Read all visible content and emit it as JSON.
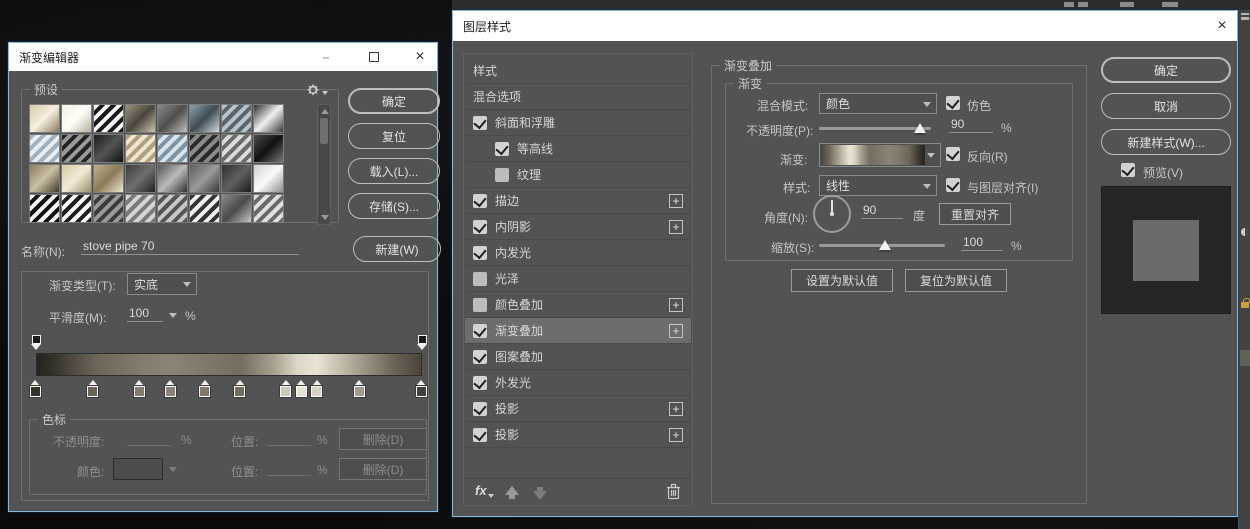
{
  "colors": {
    "dialog_bg": "#535353",
    "titlebar_bg": "#ffffff",
    "accent_border": "#86b7dc",
    "selected_row": "#6d6d6d",
    "disabled_text": "#8f8f8f",
    "preview_bg": "#262626",
    "preview_inner": "#6a6a6a"
  },
  "gradient_editor": {
    "title": "渐变编辑器",
    "window_buttons": {
      "minimize": "–",
      "maximize": "",
      "close": "×"
    },
    "presets_label": "预设",
    "gear_icon": "gear-menu",
    "buttons": {
      "ok": "确定",
      "reset": "复位",
      "load": "载入(L)...",
      "save": "存储(S)..."
    },
    "name_label": "名称(N):",
    "name_value": "stove pipe 70",
    "new_button": "新建(W)",
    "type_label": "渐变类型(T):",
    "type_value": "实底",
    "smoothness_label": "平滑度(M):",
    "smoothness_value": "100",
    "percent": "%",
    "stops_section_label": "色标",
    "opacity_row": {
      "label": "不透明度:",
      "value": "",
      "location_label": "位置:",
      "location_value": "",
      "unit": "%",
      "delete": "删除(D)"
    },
    "color_row": {
      "label": "颜色:",
      "location_label": "位置:",
      "location_value": "",
      "unit": "%",
      "delete": "删除(D)"
    },
    "swatches": [
      {
        "g": [
          "#d9c9a8",
          "#f5efe0",
          "#8a7a5e"
        ]
      },
      {
        "g": [
          "#f2efe6",
          "#fffdf8",
          "#b8b0a0"
        ]
      },
      {
        "st": [
          "#f8f8f8",
          "#1a1a1a"
        ]
      },
      {
        "g": [
          "#9a937f",
          "#4a463c",
          "#c8c2ae"
        ]
      },
      {
        "g": [
          "#8a8a8a",
          "#4e4e4e",
          "#c0c0c0"
        ]
      },
      {
        "g": [
          "#8fa2ad",
          "#3e4a52",
          "#cdd8de"
        ]
      },
      {
        "st": [
          "#b8c4cc",
          "#5a646b"
        ]
      },
      {
        "g": [
          "#2e2e2e",
          "#f0f0f0",
          "#3a3a3a"
        ]
      },
      {
        "st": [
          "#9fb2bd",
          "#e8eef2"
        ]
      },
      {
        "st": [
          "#232323",
          "#999999"
        ]
      },
      {
        "g": [
          "#1c1c1c",
          "#555555",
          "#0f0f0f"
        ]
      },
      {
        "st": [
          "#b0a080",
          "#efe6d0"
        ]
      },
      {
        "st": [
          "#7e96a4",
          "#d8e4ea"
        ]
      },
      {
        "st": [
          "#2a2a2a",
          "#8a8a8a"
        ]
      },
      {
        "st": [
          "#6a6a6a",
          "#dadada"
        ]
      },
      {
        "g": [
          "#4c4c4c",
          "#111111",
          "#777777"
        ]
      },
      {
        "g": [
          "#8a7f62",
          "#c9bfa2",
          "#3f382a"
        ]
      },
      {
        "g": [
          "#d6c8a4",
          "#f2ead6",
          "#9a8c6a"
        ]
      },
      {
        "g": [
          "#c2b190",
          "#8a7a58",
          "#efe8d4"
        ]
      },
      {
        "g": [
          "#3c3c3c",
          "#6e6e6e",
          "#222222"
        ]
      },
      {
        "g": [
          "#555555",
          "#bbbbbb",
          "#333333"
        ]
      },
      {
        "g": [
          "#5e5e5e",
          "#9a9a9a",
          "#3a3a3a"
        ]
      },
      {
        "g": [
          "#2f2f2f",
          "#606060",
          "#1c1c1c"
        ]
      },
      {
        "g": [
          "#cfcfcf",
          "#fafafa",
          "#8e8e8e"
        ]
      },
      {
        "st": [
          "#f2f2f2",
          "#101010"
        ]
      },
      {
        "st": [
          "#ffffff",
          "#202020"
        ]
      },
      {
        "st": [
          "#9a9a9a",
          "#3c3c3c"
        ]
      },
      {
        "st": [
          "#d5d5d5",
          "#7a7a7a"
        ]
      },
      {
        "st": [
          "#c8c8c8",
          "#555555"
        ]
      },
      {
        "st": [
          "#333333",
          "#eeeeee"
        ]
      },
      {
        "g": [
          "#8c8c8c",
          "#4a4a4a",
          "#c4c4c4"
        ]
      },
      {
        "st": [
          "#e0e0e0",
          "#6a6a6a"
        ]
      }
    ],
    "bar_gradient": [
      {
        "pos": 0,
        "color": "#26221c"
      },
      {
        "pos": 4,
        "color": "#35302a"
      },
      {
        "pos": 15,
        "color": "#6b6458"
      },
      {
        "pos": 27,
        "color": "#837c6e"
      },
      {
        "pos": 35,
        "color": "#8b8476"
      },
      {
        "pos": 44,
        "color": "#7f786b"
      },
      {
        "pos": 53,
        "color": "#746d60"
      },
      {
        "pos": 62,
        "color": "#aaa391"
      },
      {
        "pos": 68,
        "color": "#ddd7c7"
      },
      {
        "pos": 73,
        "color": "#e9e3d4"
      },
      {
        "pos": 79,
        "color": "#c4bdac"
      },
      {
        "pos": 86,
        "color": "#978f7f"
      },
      {
        "pos": 93,
        "color": "#6b6356"
      },
      {
        "pos": 98,
        "color": "#554e43"
      },
      {
        "pos": 100,
        "color": "#4a443a"
      }
    ],
    "opacity_stops": [
      {
        "pos": 0
      },
      {
        "pos": 100
      }
    ],
    "color_stops": [
      {
        "pos": 0,
        "color": "#35302a"
      },
      {
        "pos": 15,
        "color": "#6b6458"
      },
      {
        "pos": 27,
        "color": "#837c6e"
      },
      {
        "pos": 35,
        "color": "#8b8476"
      },
      {
        "pos": 44,
        "color": "#7f786b"
      },
      {
        "pos": 53,
        "color": "#746d60"
      },
      {
        "pos": 65,
        "color": "#cfc9b9"
      },
      {
        "pos": 69,
        "color": "#e9e3d4"
      },
      {
        "pos": 73,
        "color": "#d8d2c2"
      },
      {
        "pos": 84,
        "color": "#a39b8b"
      },
      {
        "pos": 100,
        "color": "#45403a"
      }
    ]
  },
  "layer_style": {
    "title": "图层样式",
    "close": "×",
    "list": [
      {
        "label": "样式",
        "type": "plain"
      },
      {
        "label": "混合选项",
        "type": "plain"
      },
      {
        "label": "斜面和浮雕",
        "checked": true
      },
      {
        "label": "等高线",
        "checked": true,
        "indent": true
      },
      {
        "label": "纹理",
        "checked": false,
        "indent": true
      },
      {
        "label": "描边",
        "checked": true,
        "plus": true
      },
      {
        "label": "内阴影",
        "checked": true,
        "plus": true
      },
      {
        "label": "内发光",
        "checked": true
      },
      {
        "label": "光泽",
        "checked": false
      },
      {
        "label": "颜色叠加",
        "checked": false,
        "plus": true
      },
      {
        "label": "渐变叠加",
        "checked": true,
        "plus": true,
        "selected": true
      },
      {
        "label": "图案叠加",
        "checked": true
      },
      {
        "label": "外发光",
        "checked": true
      },
      {
        "label": "投影",
        "checked": true,
        "plus": true
      },
      {
        "label": "投影",
        "checked": true,
        "plus": true
      }
    ],
    "footer_icons": [
      "fx-menu",
      "move-up",
      "move-down",
      "trash"
    ],
    "panel": {
      "group_title": "渐变叠加",
      "sub_title": "渐变",
      "blend_label": "混合模式:",
      "blend_value": "颜色",
      "dither_label": "仿色",
      "dither_checked": true,
      "opacity_label": "不透明度(P):",
      "opacity_value": "90",
      "opacity_thumb_pct": 90,
      "gradient_label": "渐变:",
      "reverse_label": "反向(R)",
      "reverse_checked": true,
      "style_label": "样式:",
      "style_value": "线性",
      "align_label": "与图层对齐(I)",
      "align_checked": true,
      "angle_label": "角度(N):",
      "angle_value": "90",
      "degree_unit": "度",
      "reset_align_button": "重置对齐",
      "scale_label": "缩放(S):",
      "scale_value": "100",
      "scale_thumb_pct": 52,
      "percent": "%",
      "make_default_button": "设置为默认值",
      "reset_default_button": "复位为默认值"
    },
    "side": {
      "ok": "确定",
      "cancel": "取消",
      "new_style": "新建样式(W)...",
      "preview_label": "预览(V)",
      "preview_checked": true
    }
  }
}
